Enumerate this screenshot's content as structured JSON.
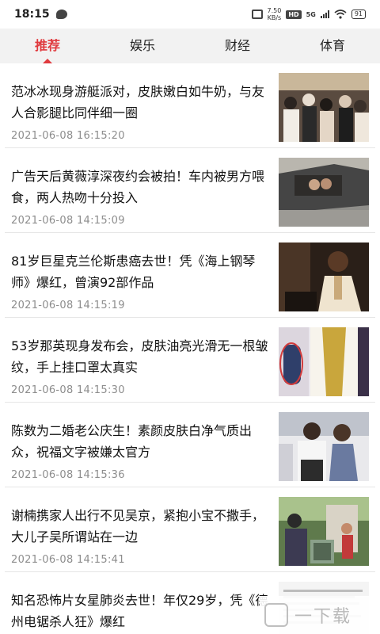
{
  "status_bar": {
    "time": "18:15",
    "net_speed_value": "7.50",
    "net_speed_unit": "KB/s",
    "hd_badge": "HD",
    "network": "5G",
    "battery": "91"
  },
  "tabs": [
    {
      "label": "推荐",
      "active": true
    },
    {
      "label": "娱乐",
      "active": false
    },
    {
      "label": "财经",
      "active": false
    },
    {
      "label": "体育",
      "active": false
    }
  ],
  "articles": [
    {
      "title": "范冰冰现身游艇派对，皮肤嫩白如牛奶，与友人合影腿比同伴细一圈",
      "time": "2021-06-08 16:15:20"
    },
    {
      "title": "广告天后黄薇淳深夜约会被拍！车内被男方喂食，两人热吻十分投入",
      "time": "2021-06-08 14:15:09"
    },
    {
      "title": "81岁巨星克兰伦斯患癌去世！凭《海上钢琴师》爆红，曾演92部作品",
      "time": "2021-06-08 14:15:19"
    },
    {
      "title": "53岁那英现身发布会，皮肤油亮光滑无一根皱纹，手上挂口罩太真实",
      "time": "2021-06-08 14:15:30"
    },
    {
      "title": "陈数为二婚老公庆生！素颜皮肤白净气质出众，祝福文字被嫌太官方",
      "time": "2021-06-08 14:15:36"
    },
    {
      "title": "谢楠携家人出行不见吴京，紧抱小宝不撒手，大儿子吴所谓站在一边",
      "time": "2021-06-08 14:15:41"
    },
    {
      "title": "知名恐怖片女星肺炎去世！年仅29岁，凭《德州电锯杀人狂》爆红",
      "time": ""
    }
  ],
  "watermark": {
    "text": "一下载"
  },
  "colors": {
    "accent": "#e03a3e",
    "tab_bg": "#f2f2f2",
    "time_text": "#8d8d8d",
    "divider": "#e6e6e6"
  }
}
